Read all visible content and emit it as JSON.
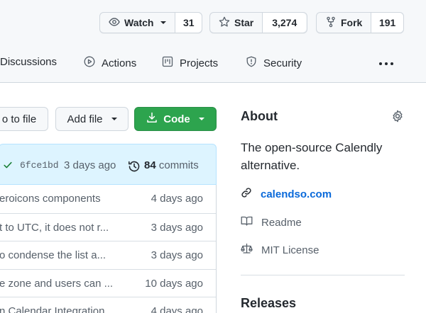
{
  "header": {
    "watch": {
      "label": "Watch",
      "count": "31"
    },
    "star": {
      "label": "Star",
      "count": "3,274"
    },
    "fork": {
      "label": "Fork",
      "count": "191"
    }
  },
  "tabs": [
    {
      "label": "Discussions",
      "icon": "discussions-icon"
    },
    {
      "label": "Actions",
      "icon": "play-icon"
    },
    {
      "label": "Projects",
      "icon": "project-icon"
    },
    {
      "label": "Security",
      "icon": "shield-icon"
    }
  ],
  "buttons": {
    "goto_file": "o to file",
    "add_file": "Add file",
    "code": "Code"
  },
  "latest_commit": {
    "sha": "6fce1bd",
    "age": "3 days ago",
    "commit_count": "84",
    "commit_label": "commits"
  },
  "files": [
    {
      "message": "eroicons components",
      "time": "4 days ago"
    },
    {
      "message": "t to UTC, it does not r...",
      "time": "3 days ago"
    },
    {
      "message": "o condense the list a...",
      "time": "3 days ago"
    },
    {
      "message": "e zone and users can ...",
      "time": "10 days ago"
    },
    {
      "message": "n Calendar Integration",
      "time": "4 days ago"
    }
  ],
  "about": {
    "title": "About",
    "description": "The open-source Calendly alternative.",
    "homepage": "calendso.com",
    "readme": "Readme",
    "license": "MIT License"
  },
  "releases": {
    "title": "Releases"
  },
  "colors": {
    "accent_green": "#2da44e",
    "link_blue": "#0969da",
    "commit_bar_bg": "#ddf4ff",
    "header_bg": "#f6f8fa"
  }
}
